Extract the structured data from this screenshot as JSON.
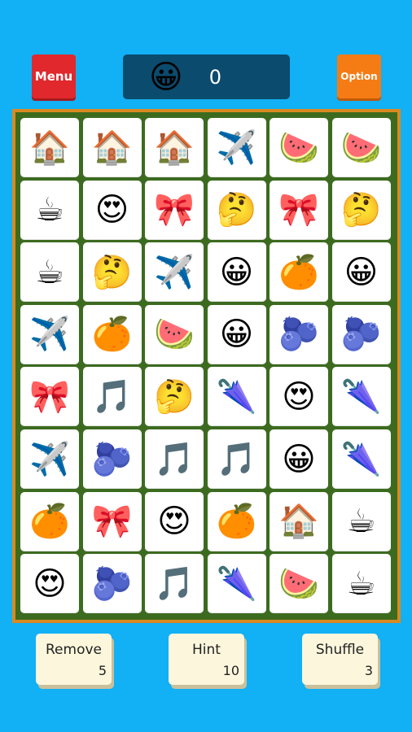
{
  "header": {
    "menu_label": "Menu",
    "option_label": "Option",
    "score_icon": "😀",
    "score": "0"
  },
  "board": {
    "rows": [
      [
        "house",
        "house",
        "house",
        "airplane",
        "watermelon",
        "watermelon"
      ],
      [
        "coffee",
        "heart-eyes",
        "ribbon",
        "thinking",
        "ribbon",
        "thinking"
      ],
      [
        "coffee",
        "thinking",
        "airplane",
        "grinning",
        "orange",
        "grinning"
      ],
      [
        "airplane",
        "orange",
        "watermelon",
        "grinning",
        "blueberries",
        "blueberries"
      ],
      [
        "ribbon",
        "music-notes",
        "thinking",
        "umbrella",
        "heart-eyes",
        "umbrella"
      ],
      [
        "airplane",
        "blueberries",
        "music-notes",
        "music-notes",
        "grinning",
        "umbrella"
      ],
      [
        "orange",
        "ribbon",
        "heart-eyes",
        "orange",
        "house",
        "coffee"
      ],
      [
        "heart-eyes",
        "blueberries",
        "music-notes",
        "umbrella",
        "watermelon",
        "coffee"
      ]
    ],
    "glyphs": {
      "house": "🏠",
      "airplane": "✈️",
      "watermelon": "🍉",
      "coffee": "☕",
      "heart-eyes": "😍",
      "ribbon": "🎀",
      "thinking": "🤔",
      "grinning": "😀",
      "orange": "🍊",
      "blueberries": "🫐",
      "music-notes": "🎵",
      "umbrella": "🌂"
    }
  },
  "powerups": [
    {
      "label": "Remove",
      "count": "5"
    },
    {
      "label": "Hint",
      "count": "10"
    },
    {
      "label": "Shuffle",
      "count": "3"
    }
  ],
  "colors": {
    "background": "#12b0f5",
    "menu": "#e0282d",
    "option": "#f57c14",
    "score_panel": "#0b4b6e",
    "board_frame": "#d88a22",
    "tile": "#ffffff",
    "powerup": "#fbf6dc"
  }
}
